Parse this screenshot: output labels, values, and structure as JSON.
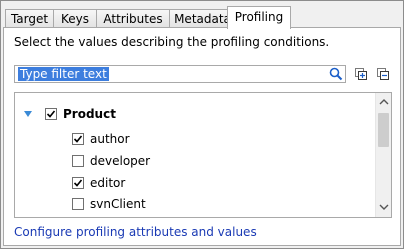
{
  "tabs": [
    {
      "label": "Target"
    },
    {
      "label": "Keys"
    },
    {
      "label": "Attributes"
    },
    {
      "label": "Metadata"
    },
    {
      "label": "Profiling",
      "active": true
    }
  ],
  "description": "Select the values describing the profiling conditions.",
  "filter": {
    "text": "Type filter text"
  },
  "tree": {
    "root": {
      "label": "Product",
      "checked": true,
      "expanded": true
    },
    "items": [
      {
        "label": "author",
        "checked": true
      },
      {
        "label": "developer",
        "checked": false
      },
      {
        "label": "editor",
        "checked": true
      },
      {
        "label": "svnClient",
        "checked": false
      }
    ]
  },
  "configure_link": "Configure profiling attributes and values",
  "colors": {
    "selection": "#3d7ede",
    "link": "#1a3ab4",
    "search_icon": "#1c5fc9"
  },
  "icons": [
    "search-icon",
    "expand-all-icon",
    "collapse-all-icon",
    "expander-arrow-icon",
    "scroll-up-icon",
    "scroll-down-icon"
  ]
}
